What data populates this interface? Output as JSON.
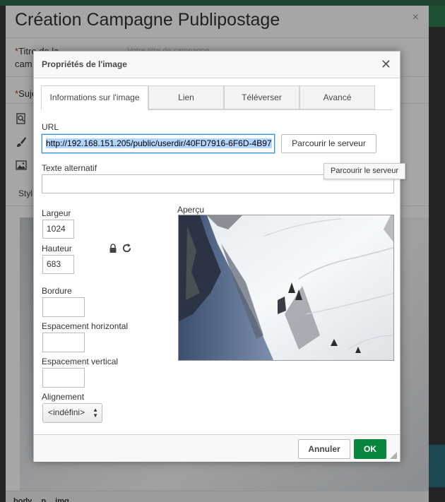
{
  "background": {
    "title": "Création Campagne Publipostage",
    "field1_label_line1": "Titre de la",
    "field1_label_line2": "cam",
    "field1_required": "*",
    "field1_placeholder": "Votre titre de campagne",
    "field2_label": "Suje",
    "field2_required": "*",
    "style_label": "Styl",
    "path": [
      "body",
      "p",
      "img"
    ],
    "close_glyph": "×"
  },
  "dialog": {
    "title": "Propriétés de l'image",
    "close_glyph": "✕",
    "tabs": [
      {
        "label": "Informations sur l'image",
        "active": true
      },
      {
        "label": "Lien",
        "active": false
      },
      {
        "label": "Téléverser",
        "active": false
      },
      {
        "label": "Avancé",
        "active": false
      }
    ],
    "url": {
      "label": "URL",
      "value": "http://192.168.151.205/public/userdir/40FD7916-6F6D-4B97"
    },
    "browse_button": "Parcourir le serveur",
    "tooltip": "Parcourir le serveur",
    "alt_text": {
      "label": "Texte alternatif",
      "value": ""
    },
    "width": {
      "label": "Largeur",
      "value": "1024"
    },
    "height": {
      "label": "Hauteur",
      "value": "683"
    },
    "border": {
      "label": "Bordure",
      "value": ""
    },
    "hspace": {
      "label": "Espacement horizontal",
      "value": ""
    },
    "vspace": {
      "label": "Espacement vertical",
      "value": ""
    },
    "alignment": {
      "label": "Alignement",
      "value": "<indéfini>"
    },
    "preview_label": "Aperçu",
    "cancel_button": "Annuler",
    "ok_button": "OK"
  },
  "colors": {
    "ok_green": "#09863e",
    "focus_blue": "#3b8ed8",
    "selection_blue": "#b3d4fc"
  }
}
